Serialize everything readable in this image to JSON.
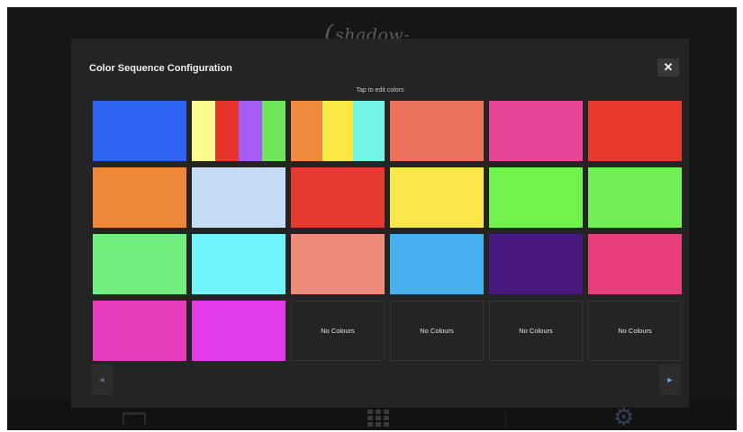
{
  "app": {
    "logo_text": "shadow-caster"
  },
  "dialog": {
    "title": "Color Sequence Configuration",
    "close_label": "✕",
    "hint": "Tap to edit colors",
    "prev_label": "◄",
    "next_label": "►"
  },
  "tiles": [
    {
      "type": "solid",
      "colors": [
        "#2e64f2"
      ]
    },
    {
      "type": "stripes",
      "colors": [
        "#fdfb8e",
        "#e8352b",
        "#a45cf5",
        "#6fe55a"
      ]
    },
    {
      "type": "stripes",
      "colors": [
        "#ef8a3c",
        "#fae843",
        "#72f4e2"
      ]
    },
    {
      "type": "solid",
      "colors": [
        "#eb735e"
      ]
    },
    {
      "type": "solid",
      "colors": [
        "#e94596"
      ]
    },
    {
      "type": "solid",
      "colors": [
        "#e8392c"
      ]
    },
    {
      "type": "solid",
      "colors": [
        "#ec8837"
      ]
    },
    {
      "type": "solid",
      "colors": [
        "#c4dcf6"
      ]
    },
    {
      "type": "solid",
      "colors": [
        "#e63a31"
      ]
    },
    {
      "type": "solid",
      "colors": [
        "#fae74b"
      ]
    },
    {
      "type": "solid",
      "colors": [
        "#72f24c"
      ]
    },
    {
      "type": "solid",
      "colors": [
        "#72ef56"
      ]
    },
    {
      "type": "solid",
      "colors": [
        "#70ee7e"
      ]
    },
    {
      "type": "solid",
      "colors": [
        "#6ff5fb"
      ]
    },
    {
      "type": "solid",
      "colors": [
        "#ee8a79"
      ]
    },
    {
      "type": "solid",
      "colors": [
        "#45b2ef"
      ]
    },
    {
      "type": "solid",
      "colors": [
        "#48187f"
      ]
    },
    {
      "type": "solid",
      "colors": [
        "#e93d7e"
      ]
    },
    {
      "type": "solid",
      "colors": [
        "#e73cbc"
      ]
    },
    {
      "type": "solid",
      "colors": [
        "#e23be8"
      ]
    },
    {
      "type": "empty",
      "label": "No Colours"
    },
    {
      "type": "empty",
      "label": "No Colours"
    },
    {
      "type": "empty",
      "label": "No Colours"
    },
    {
      "type": "empty",
      "label": "No Colours"
    }
  ],
  "bottom_nav": {
    "icons": [
      "home-icon",
      "grid-icon",
      "gear-icon"
    ],
    "active_color": "#34405a"
  }
}
